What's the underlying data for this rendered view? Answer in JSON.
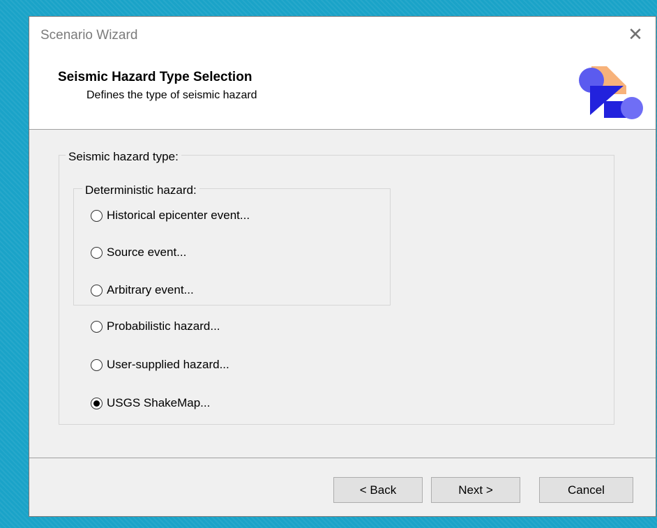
{
  "window": {
    "title": "Scenario Wizard",
    "close_glyph": "✕"
  },
  "header": {
    "title": "Seismic Hazard Type Selection",
    "subtitle": "Defines the type of seismic hazard",
    "logo_icon": "wizard-shapes-icon",
    "logo_colors": {
      "blue": "#3a3adf",
      "peach": "#f7b27a",
      "violet": "#6f6ef5"
    }
  },
  "hazard_group": {
    "legend": "Seismic hazard type:",
    "deterministic": {
      "legend": "Deterministic hazard:",
      "options": [
        {
          "label": "Historical epicenter event...",
          "selected": false
        },
        {
          "label": "Source event...",
          "selected": false
        },
        {
          "label": "Arbitrary event...",
          "selected": false
        }
      ]
    },
    "other_options": [
      {
        "label": "Probabilistic hazard...",
        "selected": false
      },
      {
        "label": "User-supplied hazard...",
        "selected": false
      },
      {
        "label": "USGS ShakeMap...",
        "selected": true
      }
    ]
  },
  "buttons": {
    "back": "< Back",
    "next": "Next >",
    "cancel": "Cancel"
  }
}
